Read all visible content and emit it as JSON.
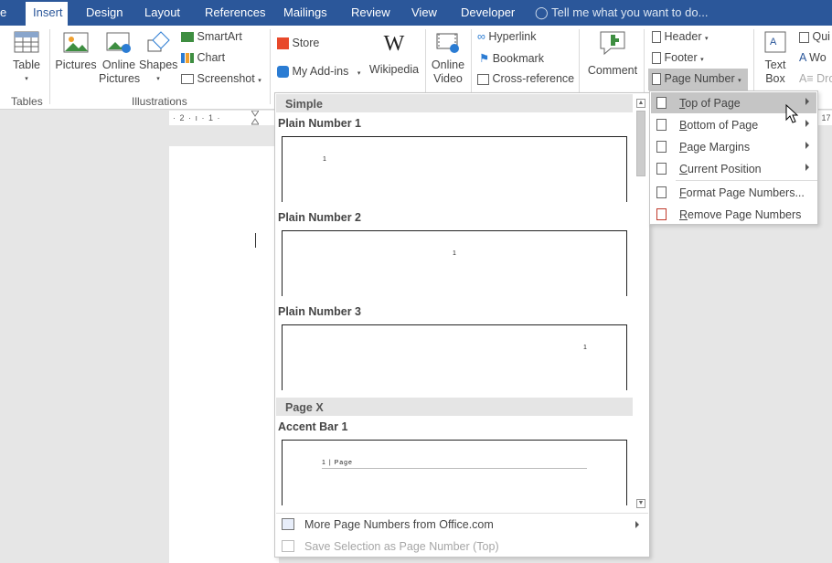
{
  "tabs": [
    {
      "id": "file",
      "label": "e"
    },
    {
      "id": "insert",
      "label": "Insert"
    },
    {
      "id": "design",
      "label": "Design"
    },
    {
      "id": "layout",
      "label": "Layout"
    },
    {
      "id": "references",
      "label": "References"
    },
    {
      "id": "mailings",
      "label": "Mailings"
    },
    {
      "id": "review",
      "label": "Review"
    },
    {
      "id": "view",
      "label": "View"
    },
    {
      "id": "developer",
      "label": "Developer"
    }
  ],
  "tell_me": "Tell me what you want to do...",
  "ribbon": {
    "table": "Table",
    "pictures": "Pictures",
    "online_pictures_1": "Online",
    "online_pictures_2": "Pictures",
    "shapes": "Shapes",
    "smartart": "SmartArt",
    "chart": "Chart",
    "screenshot": "Screenshot",
    "store": "Store",
    "my_addins": "My Add-ins",
    "wikipedia": "Wikipedia",
    "online_video_1": "Online",
    "online_video_2": "Video",
    "hyperlink": "Hyperlink",
    "bookmark": "Bookmark",
    "cross_reference": "Cross-reference",
    "comment": "Comment",
    "header": "Header",
    "footer": "Footer",
    "page_number": "Page Number",
    "text_box_1": "Text",
    "text_box_2": "Box",
    "quick_parts": "Qui",
    "wordart": "Wo",
    "drop_cap": "Dro",
    "groups": {
      "tables": "Tables",
      "illustrations": "Illustrations"
    }
  },
  "ruler": {
    "left": "· 2 · ı · 1 ·",
    "right": "· 17"
  },
  "gallery": {
    "sections": [
      "Simple",
      "Page X"
    ],
    "items": [
      {
        "name": "Plain Number 1",
        "number": "1"
      },
      {
        "name": "Plain Number 2",
        "number": "1"
      },
      {
        "name": "Plain Number 3",
        "number": "1"
      },
      {
        "name": "Accent Bar 1",
        "number": "1 | Page"
      }
    ],
    "more": "More Page Numbers from Office.com",
    "save_selection": "Save Selection as Page Number (Top)"
  },
  "submenu": {
    "items": [
      {
        "u": "T",
        "rest": "op of Page",
        "has_submenu": true,
        "highlighted": true
      },
      {
        "u": "B",
        "rest": "ottom of Page",
        "has_submenu": true
      },
      {
        "u": "P",
        "rest": "age Margins",
        "has_submenu": true
      },
      {
        "u": "C",
        "rest": "urrent Position",
        "has_submenu": true
      },
      {
        "u": "F",
        "rest": "ormat Page Numbers...",
        "has_submenu": false
      },
      {
        "u": "R",
        "rest": "emove Page Numbers",
        "has_submenu": false
      }
    ]
  },
  "colors": {
    "tab_bar": "#2b579a",
    "highlight": "#c5c5c5"
  }
}
